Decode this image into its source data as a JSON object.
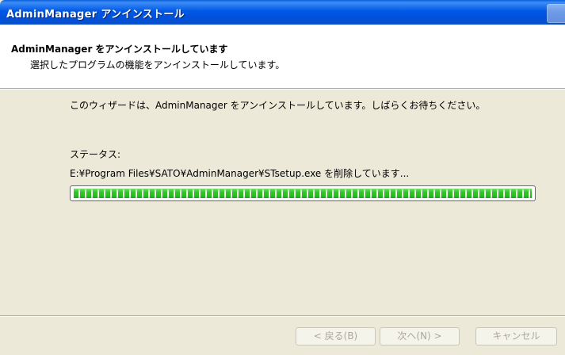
{
  "window": {
    "title": "AdminManager アンインストール"
  },
  "header": {
    "title": "AdminManager をアンインストールしています",
    "subtitle": "選択したプログラムの機能をアンインストールしています。"
  },
  "body": {
    "message": "このウィザードは、AdminManager をアンインストールしています。しばらくお待ちください。",
    "status_label": "ステータス:",
    "status_detail": "E:¥Program Files¥SATO¥AdminManager¥STsetup.exe を削除しています..."
  },
  "progress": {
    "percent": 100
  },
  "buttons": {
    "back": "< 戻る(B)",
    "next": "次へ(N) >",
    "cancel": "キャンセル"
  }
}
